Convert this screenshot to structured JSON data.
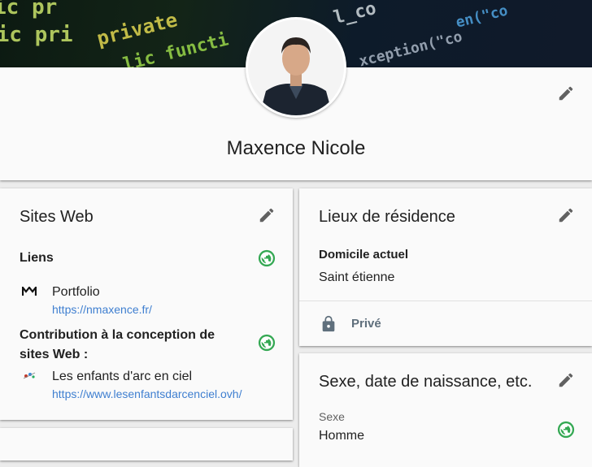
{
  "profile": {
    "name": "Maxence Nicole",
    "edit_icon": "pencil-icon"
  },
  "banner": {
    "code_lines": [
      "ic pr",
      "lic pri",
      "private",
      "lic functi",
      "l_co",
      "xception(\"co",
      "en(\"co"
    ]
  },
  "websites": {
    "title": "Sites Web",
    "links_heading": "Liens",
    "links": [
      {
        "name": "Portfolio",
        "url": "https://nmaxence.fr/"
      }
    ],
    "contribution_heading": "Contribution à la conception de sites Web :",
    "contributions": [
      {
        "name": "Les enfants d'arc en ciel",
        "url": "https://www.lesenfantsdarcenciel.ovh/"
      }
    ]
  },
  "residence": {
    "title": "Lieux de résidence",
    "current_label": "Domicile actuel",
    "current_value": "Saint étienne",
    "privacy_label": "Privé"
  },
  "identity": {
    "title": "Sexe, date de naissance, etc.",
    "sex_label": "Sexe",
    "sex_value": "Homme"
  },
  "colors": {
    "link": "#3f7fd0",
    "globe": "#34a853",
    "icon": "#616161",
    "banner_text_green": "#9bd84a",
    "banner_text_yellow": "#e0d650"
  }
}
